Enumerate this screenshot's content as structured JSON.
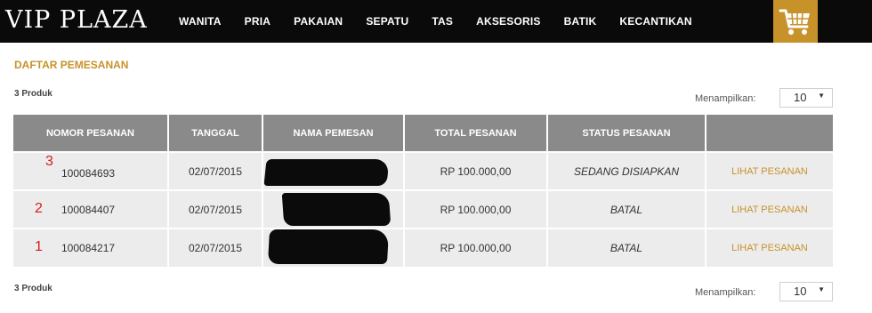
{
  "brand": {
    "logo_text": "VIP PLAZA",
    "accent_color": "#c8922a"
  },
  "nav": {
    "items": [
      "WANITA",
      "PRIA",
      "PAKAIAN",
      "SEPATU",
      "TAS",
      "AKSESORIS",
      "BATIK",
      "KECANTIKAN"
    ]
  },
  "cart": {
    "icon": "shopping-cart-icon"
  },
  "page": {
    "title": "DAFTAR PEMESANAN"
  },
  "top_controls": {
    "count_text": "3 Produk",
    "show_label": "Menampilkan:",
    "show_value": "10"
  },
  "bottom_controls": {
    "count_text": "3 Produk",
    "show_label": "Menampilkan:",
    "show_value": "10"
  },
  "table": {
    "headers": [
      "NOMOR PESANAN",
      "TANGGAL",
      "NAMA PEMESAN",
      "TOTAL PESANAN",
      "STATUS PESANAN",
      ""
    ],
    "rows": [
      {
        "marker": "3",
        "order_no": "100084693",
        "date": "02/07/2015",
        "name": "",
        "total": "RP 100.000,00",
        "status": "SEDANG DISIAPKAN",
        "action": "LIHAT PESANAN"
      },
      {
        "marker": "2",
        "order_no": "100084407",
        "date": "02/07/2015",
        "name": "",
        "total": "RP 100.000,00",
        "status": "BATAL",
        "action": "LIHAT PESANAN"
      },
      {
        "marker": "1",
        "order_no": "100084217",
        "date": "02/07/2015",
        "name": "",
        "total": "RP 100.000,00",
        "status": "BATAL",
        "action": "LIHAT PESANAN"
      }
    ]
  }
}
